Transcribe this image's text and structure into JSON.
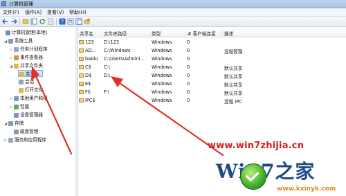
{
  "window": {
    "title": "计算机管理"
  },
  "menu": [
    "文件(F)",
    "操作(A)",
    "查看(V)",
    "帮助(H)"
  ],
  "toolbar_icons": [
    "back-icon",
    "forward-icon",
    "up-icon",
    "show-hide-tree-icon",
    "refresh-icon",
    "export-icon",
    "help-icon",
    "properties-icon",
    "list-view-icon",
    "share-icon"
  ],
  "tree": [
    {
      "label": "计算机管理(本地)",
      "indent": 0,
      "expander": "",
      "icon_color": "#6d8fbf"
    },
    {
      "label": "系统工具",
      "indent": 1,
      "expander": "◢",
      "icon_color": "#7f9cc7"
    },
    {
      "label": "任务计划程序",
      "indent": 2,
      "expander": "▷",
      "icon_color": "#9aa9bf"
    },
    {
      "label": "事件查看器",
      "indent": 2,
      "expander": "▷",
      "icon_color": "#c99b3a"
    },
    {
      "label": "共享文件夹",
      "indent": 2,
      "expander": "◢",
      "icon_color": "#e0b84f"
    },
    {
      "label": "共享",
      "indent": 3,
      "expander": "",
      "icon_color": "#e0b84f",
      "selected": true
    },
    {
      "label": "会话",
      "indent": 3,
      "expander": "",
      "icon_color": "#8fa7c7"
    },
    {
      "label": "打开文件",
      "indent": 3,
      "expander": "",
      "icon_color": "#e0b84f"
    },
    {
      "label": "本地用户和组",
      "indent": 2,
      "expander": "▷",
      "icon_color": "#7d96bb"
    },
    {
      "label": "性能",
      "indent": 2,
      "expander": "▷",
      "icon_color": "#6fa46a"
    },
    {
      "label": "设备管理器",
      "indent": 2,
      "expander": "",
      "icon_color": "#7d96bb"
    },
    {
      "label": "存储",
      "indent": 1,
      "expander": "◢",
      "icon_color": "#8a98ad"
    },
    {
      "label": "磁盘管理",
      "indent": 2,
      "expander": "",
      "icon_color": "#8a98ad"
    },
    {
      "label": "服务和应用程序",
      "indent": 1,
      "expander": "▷",
      "icon_color": "#9aa9bf"
    }
  ],
  "columns": [
    "共享名",
    "文件夹路径",
    "类型",
    "# 客户端连接",
    "描述"
  ],
  "shares": [
    {
      "name": "123",
      "path": "D:\\123",
      "type": "Windows",
      "clients": "0",
      "desc": ""
    },
    {
      "name": "AD...",
      "path": "C:\\Windows",
      "type": "Windows",
      "clients": "0",
      "desc": "远程管理"
    },
    {
      "name": "baidu",
      "path": "C:\\Users\\Admini...",
      "type": "Windows",
      "clients": "0",
      "desc": ""
    },
    {
      "name": "C$",
      "path": "C:\\",
      "type": "Windows",
      "clients": "0",
      "desc": "默认共享"
    },
    {
      "name": "D$",
      "path": "D:\\",
      "type": "Windows",
      "clients": "0",
      "desc": "默认共享"
    },
    {
      "name": "E$",
      "path": "",
      "type": "Windows",
      "clients": "0",
      "desc": "默认共享"
    },
    {
      "name": "F$",
      "path": "F:\\",
      "type": "Windows",
      "clients": "0",
      "desc": "默认共享"
    },
    {
      "name": "IPC$",
      "path": "",
      "type": "Windows",
      "clients": "0",
      "desc": "远程 IPC"
    }
  ],
  "watermark": {
    "url": "www.win7zhijia.cn",
    "brand": "Win7之家",
    "site": "www.kxinyk.com"
  }
}
